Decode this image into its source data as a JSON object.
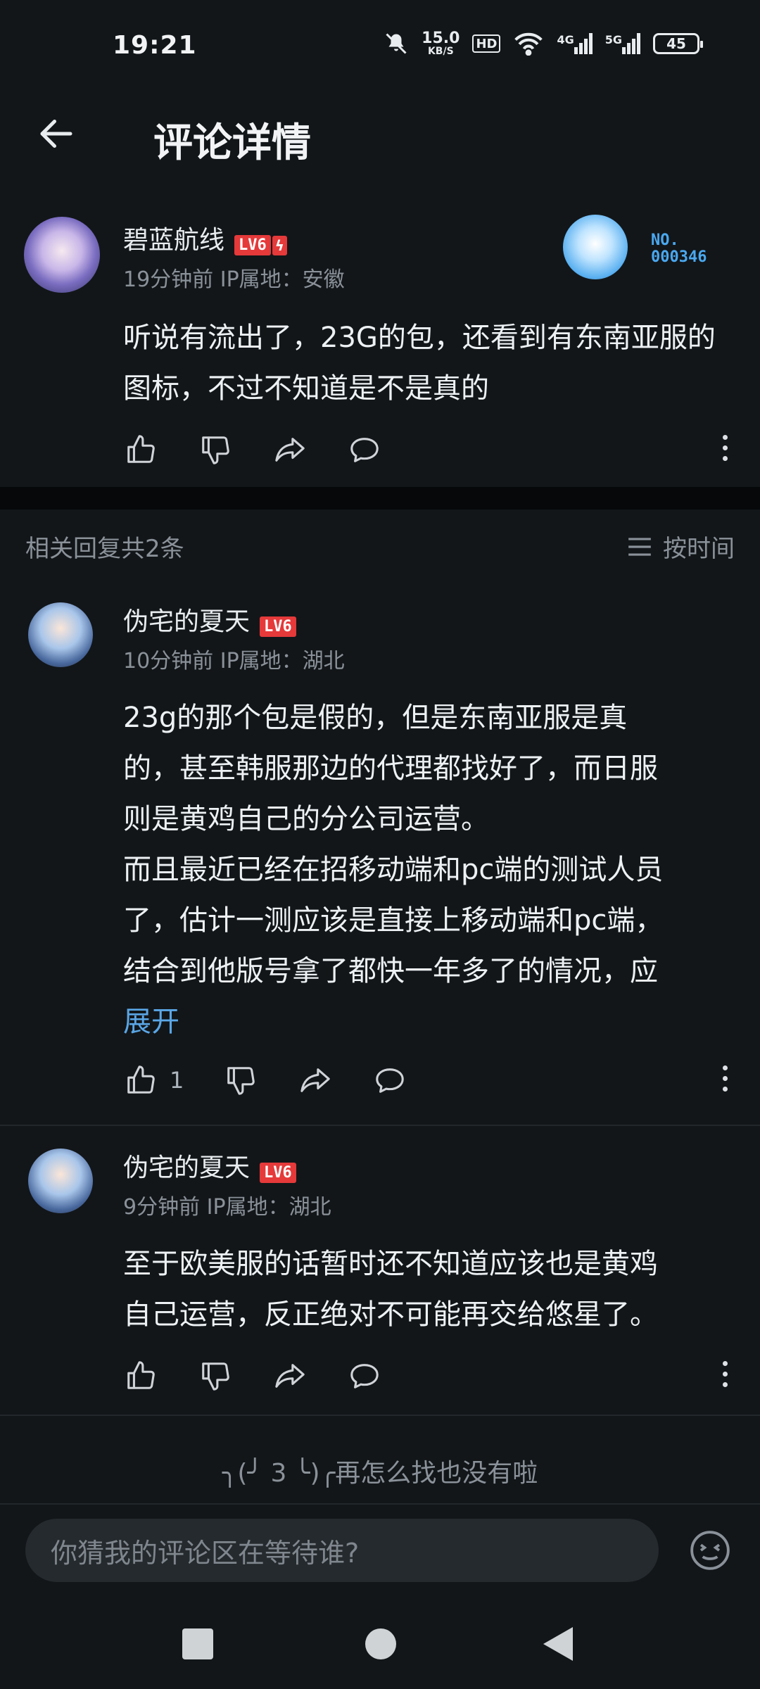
{
  "status_bar": {
    "time": "19:21",
    "net_speed_value": "15.0",
    "net_speed_unit": "KB/S",
    "hd_label": "HD",
    "sig1": "4G",
    "sig2": "5G",
    "battery": "45"
  },
  "header": {
    "title": "评论详情"
  },
  "main_comment": {
    "username": "碧蓝航线",
    "level": "LV6",
    "time": "19分钟前",
    "ip": "IP属地：安徽",
    "text": "听说有流出了，23G的包，还看到有东南亚服的图标，不过不知道是不是真的",
    "decor_no_label": "NO.",
    "decor_no_value": "000346"
  },
  "replies_header": {
    "label": "相关回复共2条",
    "sort_label": "按时间"
  },
  "replies": [
    {
      "username": "伪宅的夏天",
      "level": "LV6",
      "time": "10分钟前",
      "ip": "IP属地：湖北",
      "lines": [
        "23g的那个包是假的，但是东南亚服是真",
        "的，甚至韩服那边的代理都找好了，而日服",
        "则是黄鸡自己的分公司运营。",
        "而且最近已经在招移动端和pc端的测试人员",
        "了，估计一测应该是直接上移动端和pc端，",
        "结合到他版号拿了都快一年多了的情况，应"
      ],
      "expand_label": "展开",
      "like_count": "1"
    },
    {
      "username": "伪宅的夏天",
      "level": "LV6",
      "time": "9分钟前",
      "ip": "IP属地：湖北",
      "lines": [
        "至于欧美服的话暂时还不知道应该也是黄鸡",
        "自己运营，反正绝对不可能再交给悠星了。"
      ]
    }
  ],
  "end_text": "╮(╯ 3 ╰)╭再怎么找也没有啦",
  "input": {
    "placeholder": "你猜我的评论区在等待谁?"
  },
  "icons": {
    "back": "arrow-left-icon",
    "like": "thumbs-up-icon",
    "dislike": "thumbs-down-icon",
    "share": "share-icon",
    "comment": "comment-icon",
    "more": "more-vertical-icon",
    "sort": "sort-lines-icon",
    "emoji": "emoji-icon"
  },
  "colors": {
    "background": "#121619",
    "level_badge": "#e5393a",
    "link": "#5aa6e6",
    "meta_text": "#8a9199"
  }
}
